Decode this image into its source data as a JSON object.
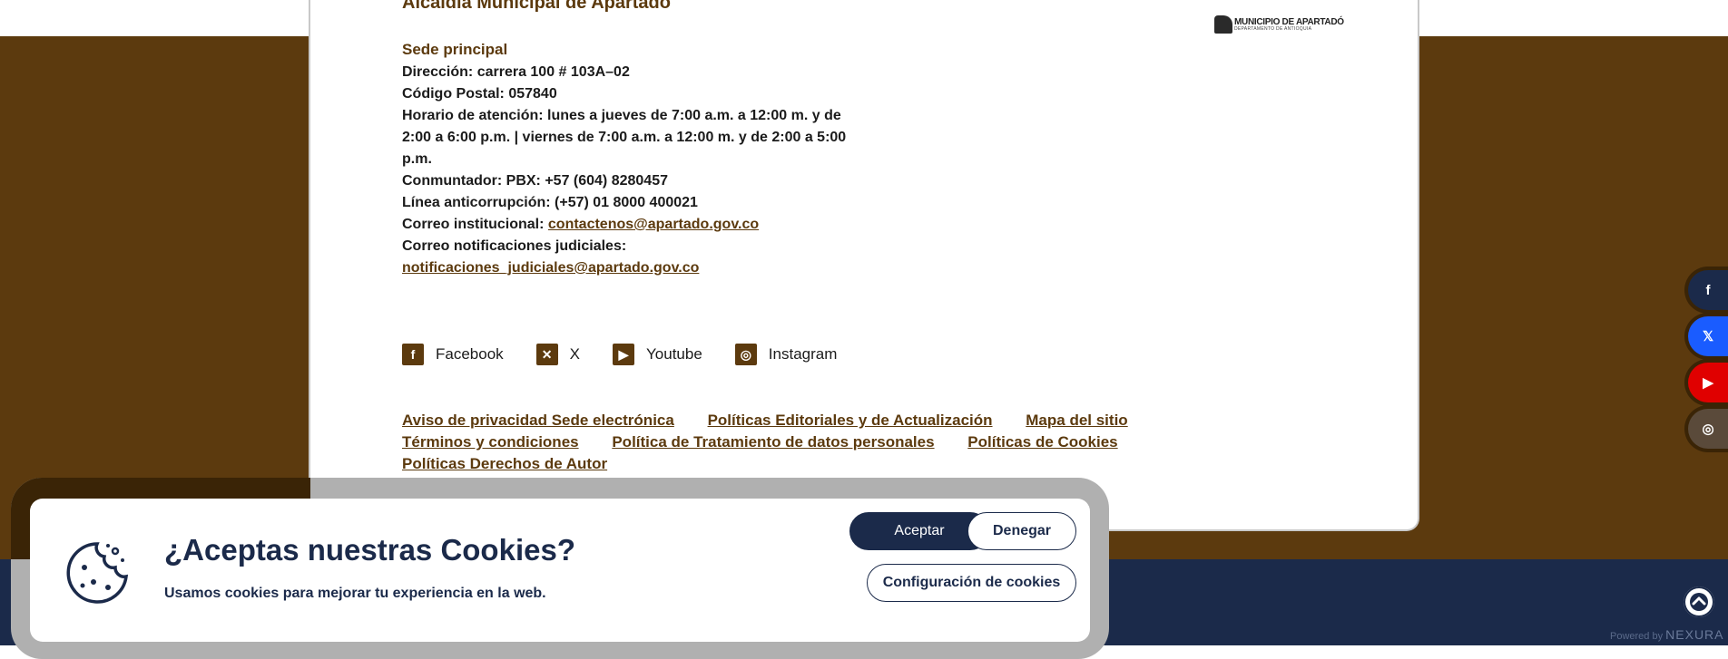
{
  "org": {
    "title": "Alcaldía Municipal de Apartadó",
    "logo_line1": "MUNICIPIO DE APARTADÓ",
    "logo_line2": "DEPARTAMENTO DE ANTIOQUIA"
  },
  "sede": {
    "heading": "Sede principal",
    "direccion": "Dirección: carrera 100 # 103A–02",
    "codigo_postal": "Código Postal: 057840",
    "horario": "Horario de atención: lunes a jueves de 7:00 a.m. a 12:00 m. y de 2:00 a 6:00 p.m. | viernes de 7:00 a.m. a 12:00 m. y de 2:00 a 5:00 p.m.",
    "conmutador": "Conmuntador: PBX: +57 (604) 8280457",
    "anticorrupcion": "Línea anticorrupción: (+57) 01 8000 400021",
    "correo_label": "Correo institucional: ",
    "correo_link": "contactenos@apartado.gov.co",
    "notif_label": "Correo notificaciones judiciales:",
    "notif_link": "notificaciones_judiciales@apartado.gov.co"
  },
  "social": [
    {
      "label": "Facebook",
      "icon": "facebook-icon",
      "glyph": "f"
    },
    {
      "label": "X",
      "icon": "x-icon",
      "glyph": "✕"
    },
    {
      "label": "Youtube",
      "icon": "youtube-icon",
      "glyph": "▶"
    },
    {
      "label": "Instagram",
      "icon": "instagram-icon",
      "glyph": "◎"
    }
  ],
  "footer_links": [
    "Aviso de privacidad Sede electrónica",
    "Políticas Editoriales y de Actualización",
    "Mapa del sitio",
    "Términos y condiciones",
    "Política de Tratamiento de datos personales",
    "Políticas de Cookies",
    "Políticas Derechos de Autor"
  ],
  "floating_share": {
    "facebook": "f",
    "x": "𝕏",
    "youtube": "▶",
    "instagram": "◎"
  },
  "cookies": {
    "title": "¿Aceptas nuestras Cookies?",
    "text": "Usamos cookies para mejorar tu experiencia en la web.",
    "accept": "Aceptar",
    "deny": "Denegar",
    "config": "Configuración de cookies"
  },
  "powered": {
    "label": "Powered by",
    "brand": "NEXURA"
  },
  "colors": {
    "brown": "#5c3a0e",
    "navy": "#1b2a4a"
  }
}
